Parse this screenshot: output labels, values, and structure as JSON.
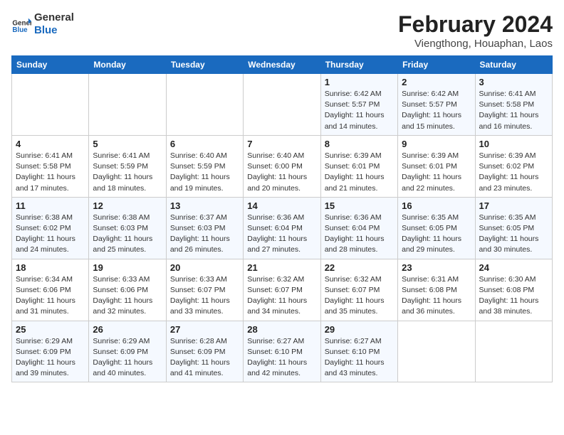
{
  "header": {
    "logo_line1": "General",
    "logo_line2": "Blue",
    "month_year": "February 2024",
    "location": "Viengthong, Houaphan, Laos"
  },
  "days_of_week": [
    "Sunday",
    "Monday",
    "Tuesday",
    "Wednesday",
    "Thursday",
    "Friday",
    "Saturday"
  ],
  "weeks": [
    [
      {
        "day": "",
        "info": ""
      },
      {
        "day": "",
        "info": ""
      },
      {
        "day": "",
        "info": ""
      },
      {
        "day": "",
        "info": ""
      },
      {
        "day": "1",
        "info": "Sunrise: 6:42 AM\nSunset: 5:57 PM\nDaylight: 11 hours\nand 14 minutes."
      },
      {
        "day": "2",
        "info": "Sunrise: 6:42 AM\nSunset: 5:57 PM\nDaylight: 11 hours\nand 15 minutes."
      },
      {
        "day": "3",
        "info": "Sunrise: 6:41 AM\nSunset: 5:58 PM\nDaylight: 11 hours\nand 16 minutes."
      }
    ],
    [
      {
        "day": "4",
        "info": "Sunrise: 6:41 AM\nSunset: 5:58 PM\nDaylight: 11 hours\nand 17 minutes."
      },
      {
        "day": "5",
        "info": "Sunrise: 6:41 AM\nSunset: 5:59 PM\nDaylight: 11 hours\nand 18 minutes."
      },
      {
        "day": "6",
        "info": "Sunrise: 6:40 AM\nSunset: 5:59 PM\nDaylight: 11 hours\nand 19 minutes."
      },
      {
        "day": "7",
        "info": "Sunrise: 6:40 AM\nSunset: 6:00 PM\nDaylight: 11 hours\nand 20 minutes."
      },
      {
        "day": "8",
        "info": "Sunrise: 6:39 AM\nSunset: 6:01 PM\nDaylight: 11 hours\nand 21 minutes."
      },
      {
        "day": "9",
        "info": "Sunrise: 6:39 AM\nSunset: 6:01 PM\nDaylight: 11 hours\nand 22 minutes."
      },
      {
        "day": "10",
        "info": "Sunrise: 6:39 AM\nSunset: 6:02 PM\nDaylight: 11 hours\nand 23 minutes."
      }
    ],
    [
      {
        "day": "11",
        "info": "Sunrise: 6:38 AM\nSunset: 6:02 PM\nDaylight: 11 hours\nand 24 minutes."
      },
      {
        "day": "12",
        "info": "Sunrise: 6:38 AM\nSunset: 6:03 PM\nDaylight: 11 hours\nand 25 minutes."
      },
      {
        "day": "13",
        "info": "Sunrise: 6:37 AM\nSunset: 6:03 PM\nDaylight: 11 hours\nand 26 minutes."
      },
      {
        "day": "14",
        "info": "Sunrise: 6:36 AM\nSunset: 6:04 PM\nDaylight: 11 hours\nand 27 minutes."
      },
      {
        "day": "15",
        "info": "Sunrise: 6:36 AM\nSunset: 6:04 PM\nDaylight: 11 hours\nand 28 minutes."
      },
      {
        "day": "16",
        "info": "Sunrise: 6:35 AM\nSunset: 6:05 PM\nDaylight: 11 hours\nand 29 minutes."
      },
      {
        "day": "17",
        "info": "Sunrise: 6:35 AM\nSunset: 6:05 PM\nDaylight: 11 hours\nand 30 minutes."
      }
    ],
    [
      {
        "day": "18",
        "info": "Sunrise: 6:34 AM\nSunset: 6:06 PM\nDaylight: 11 hours\nand 31 minutes."
      },
      {
        "day": "19",
        "info": "Sunrise: 6:33 AM\nSunset: 6:06 PM\nDaylight: 11 hours\nand 32 minutes."
      },
      {
        "day": "20",
        "info": "Sunrise: 6:33 AM\nSunset: 6:07 PM\nDaylight: 11 hours\nand 33 minutes."
      },
      {
        "day": "21",
        "info": "Sunrise: 6:32 AM\nSunset: 6:07 PM\nDaylight: 11 hours\nand 34 minutes."
      },
      {
        "day": "22",
        "info": "Sunrise: 6:32 AM\nSunset: 6:07 PM\nDaylight: 11 hours\nand 35 minutes."
      },
      {
        "day": "23",
        "info": "Sunrise: 6:31 AM\nSunset: 6:08 PM\nDaylight: 11 hours\nand 36 minutes."
      },
      {
        "day": "24",
        "info": "Sunrise: 6:30 AM\nSunset: 6:08 PM\nDaylight: 11 hours\nand 38 minutes."
      }
    ],
    [
      {
        "day": "25",
        "info": "Sunrise: 6:29 AM\nSunset: 6:09 PM\nDaylight: 11 hours\nand 39 minutes."
      },
      {
        "day": "26",
        "info": "Sunrise: 6:29 AM\nSunset: 6:09 PM\nDaylight: 11 hours\nand 40 minutes."
      },
      {
        "day": "27",
        "info": "Sunrise: 6:28 AM\nSunset: 6:09 PM\nDaylight: 11 hours\nand 41 minutes."
      },
      {
        "day": "28",
        "info": "Sunrise: 6:27 AM\nSunset: 6:10 PM\nDaylight: 11 hours\nand 42 minutes."
      },
      {
        "day": "29",
        "info": "Sunrise: 6:27 AM\nSunset: 6:10 PM\nDaylight: 11 hours\nand 43 minutes."
      },
      {
        "day": "",
        "info": ""
      },
      {
        "day": "",
        "info": ""
      }
    ]
  ]
}
